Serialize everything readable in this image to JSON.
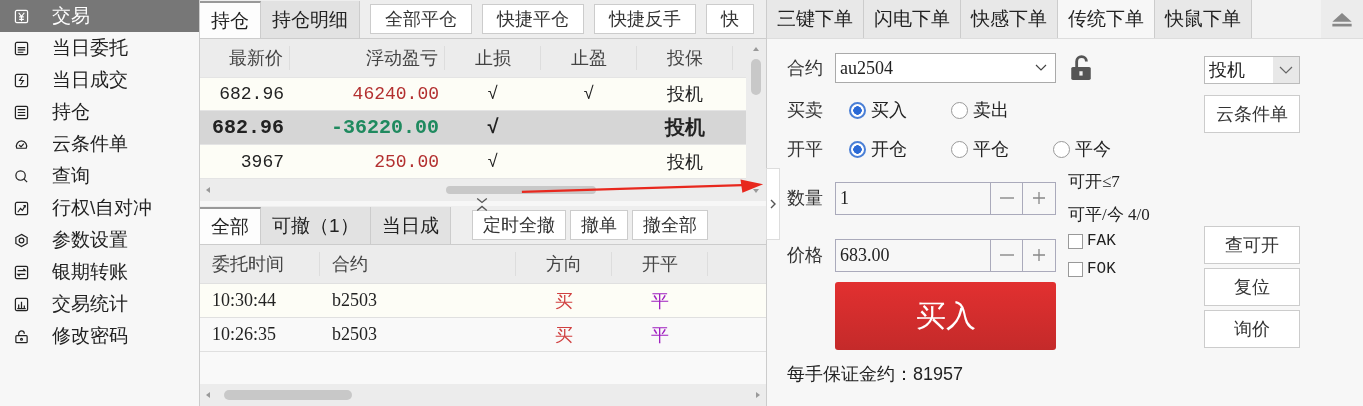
{
  "sidebar": {
    "items": [
      {
        "label": "交易",
        "selected": true
      },
      {
        "label": "当日委托",
        "selected": false
      },
      {
        "label": "当日成交",
        "selected": false
      },
      {
        "label": "持仓",
        "selected": false
      },
      {
        "label": "云条件单",
        "selected": false
      },
      {
        "label": "查询",
        "selected": false
      },
      {
        "label": "行权\\自对冲",
        "selected": false
      },
      {
        "label": "参数设置",
        "selected": false
      },
      {
        "label": "银期转账",
        "selected": false
      },
      {
        "label": "交易统计",
        "selected": false
      },
      {
        "label": "修改密码",
        "selected": false
      }
    ]
  },
  "positions": {
    "tabs": [
      {
        "label": "持仓",
        "selected": true
      },
      {
        "label": "持仓明细",
        "selected": false
      }
    ],
    "buttons": [
      "全部平仓",
      "快捷平仓",
      "快捷反手",
      "快"
    ],
    "columns": [
      "最新价",
      "浮动盈亏",
      "止损",
      "止盈",
      "投保"
    ],
    "rows": [
      {
        "selected": false,
        "kind": "profit",
        "cells": [
          "682.96",
          "46240.00",
          "√",
          "√",
          "投机"
        ]
      },
      {
        "selected": true,
        "kind": "loss",
        "cells": [
          "682.96",
          "-36220.00",
          "√",
          "",
          "投机"
        ]
      },
      {
        "selected": false,
        "kind": "profit",
        "cells": [
          "3967",
          "250.00",
          "√",
          "",
          "投机"
        ]
      }
    ]
  },
  "orders": {
    "tabs": [
      {
        "label": "全部",
        "selected": true
      },
      {
        "label": "可撤（1）",
        "selected": false
      },
      {
        "label": "当日成",
        "selected": false
      }
    ],
    "buttons": [
      "定时全撤",
      "撤单",
      "撤全部"
    ],
    "columns": [
      "委托时间",
      "合约",
      "方向",
      "开平"
    ],
    "rows": [
      {
        "cells": [
          "10:30:44",
          "b2503",
          "买",
          "平"
        ]
      },
      {
        "cells": [
          "10:26:35",
          "b2503",
          "买",
          "平"
        ]
      }
    ]
  },
  "order_panel": {
    "tabs": [
      {
        "label": "三键下单",
        "selected": false
      },
      {
        "label": "闪电下单",
        "selected": false
      },
      {
        "label": "快感下单",
        "selected": false
      },
      {
        "label": "传统下单",
        "selected": true
      },
      {
        "label": "快鼠下单",
        "selected": false
      }
    ],
    "contract_label": "合约",
    "contract": "au2504",
    "hedge": "投机",
    "cloud_button": "云条件单",
    "side_label": "买卖",
    "side_options": [
      {
        "label": "买入",
        "selected": true
      },
      {
        "label": "卖出",
        "selected": false
      }
    ],
    "offset_label": "开平",
    "offset_options": [
      {
        "label": "开仓",
        "selected": true
      },
      {
        "label": "平仓",
        "selected": false
      },
      {
        "label": "平今",
        "selected": false
      }
    ],
    "qty_label": "数量",
    "qty": "1",
    "can_open": "可开≤7",
    "can_close": "可平/今 4/0",
    "price_label": "价格",
    "price": "683.00",
    "options": [
      {
        "label": "FAK",
        "checked": false
      },
      {
        "label": "FOK",
        "checked": false
      }
    ],
    "submit": "买入",
    "side_buttons": [
      "查可开",
      "复位",
      "询价"
    ],
    "margin_note": "每手保证金约：81957"
  }
}
